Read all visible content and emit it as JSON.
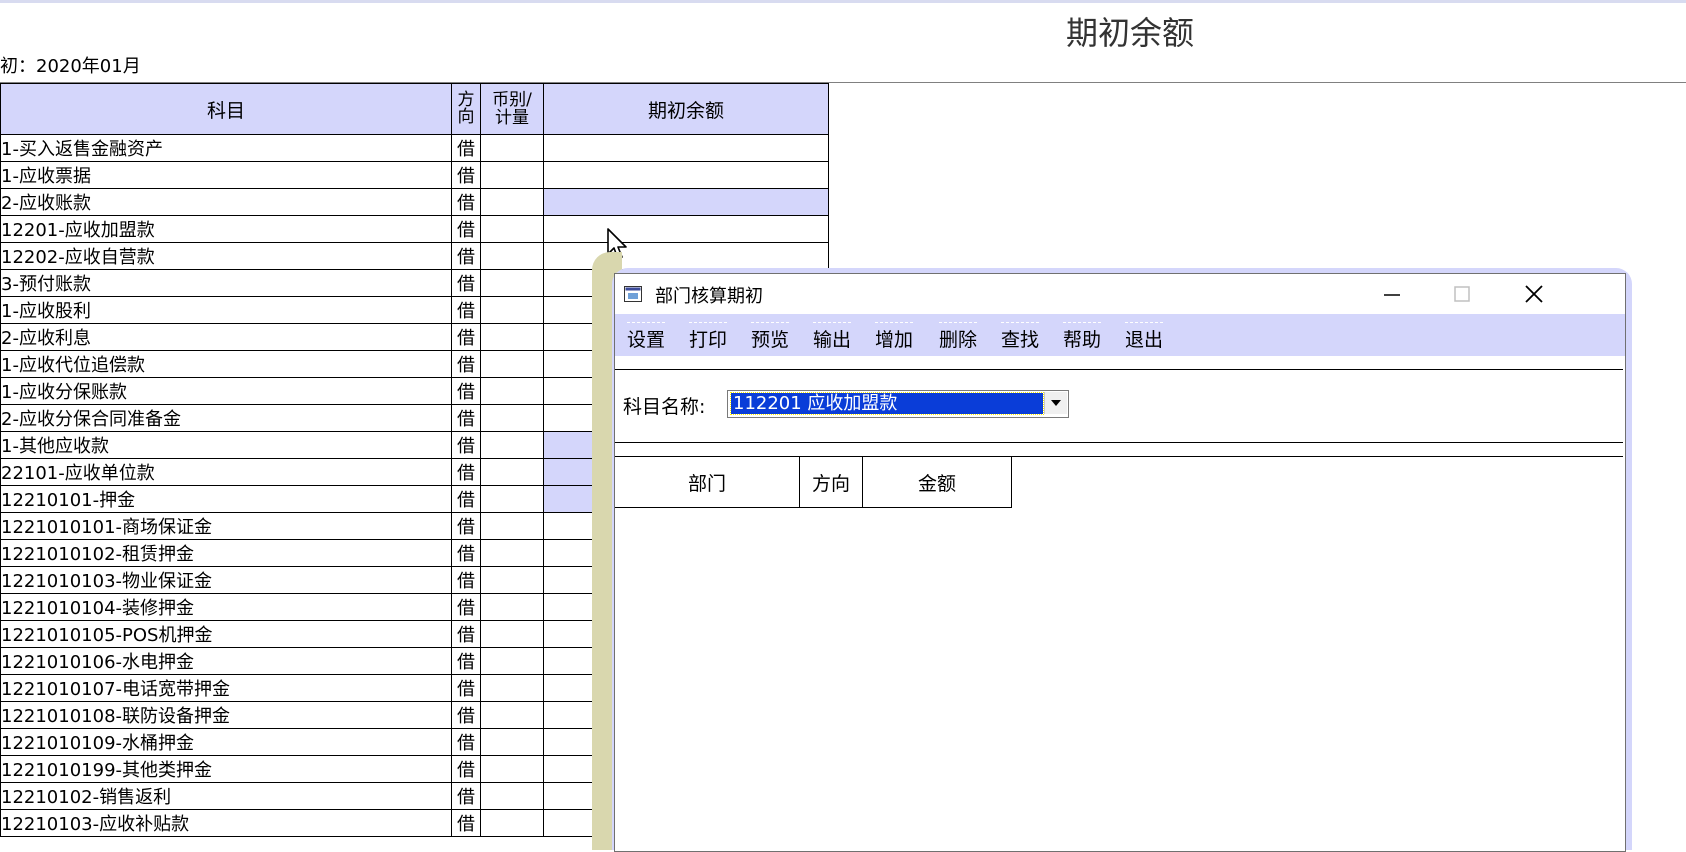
{
  "report": {
    "title": "期初余额",
    "period": "初：2020年01月"
  },
  "grid": {
    "headers": {
      "subject": "科目",
      "direction_l1": "方",
      "direction_l2": "向",
      "currency_l1": "币别/",
      "currency_l2": "计量",
      "amount": "期初余额"
    },
    "rows": [
      {
        "subject": "1-买入返售金融资产",
        "dir": "借",
        "level": 1,
        "hl": false
      },
      {
        "subject": "1-应收票据",
        "dir": "借",
        "level": 1,
        "hl": false
      },
      {
        "subject": "2-应收账款",
        "dir": "借",
        "level": 1,
        "hl": true
      },
      {
        "subject": "12201-应收加盟款",
        "dir": "借",
        "level": 1,
        "hl": false
      },
      {
        "subject": "12202-应收自营款",
        "dir": "借",
        "level": 1,
        "hl": false
      },
      {
        "subject": "3-预付账款",
        "dir": "借",
        "level": 1,
        "hl": false
      },
      {
        "subject": "1-应收股利",
        "dir": "借",
        "level": 1,
        "hl": false
      },
      {
        "subject": "2-应收利息",
        "dir": "借",
        "level": 1,
        "hl": false
      },
      {
        "subject": "1-应收代位追偿款",
        "dir": "借",
        "level": 1,
        "hl": false
      },
      {
        "subject": "1-应收分保账款",
        "dir": "借",
        "level": 1,
        "hl": false
      },
      {
        "subject": "2-应收分保合同准备金",
        "dir": "借",
        "level": 1,
        "hl": false
      },
      {
        "subject": "1-其他应收款",
        "dir": "借",
        "level": 1,
        "hl": true
      },
      {
        "subject": "22101-应收单位款",
        "dir": "借",
        "level": 1,
        "hl": true
      },
      {
        "subject": "12210101-押金",
        "dir": "借",
        "level": 2,
        "hl": true
      },
      {
        "subject": "1221010101-商场保证金",
        "dir": "借",
        "level": 3,
        "hl": false
      },
      {
        "subject": "1221010102-租赁押金",
        "dir": "借",
        "level": 3,
        "hl": false
      },
      {
        "subject": "1221010103-物业保证金",
        "dir": "借",
        "level": 3,
        "hl": false
      },
      {
        "subject": "1221010104-装修押金",
        "dir": "借",
        "level": 3,
        "hl": false
      },
      {
        "subject": "1221010105-POS机押金",
        "dir": "借",
        "level": 3,
        "hl": false
      },
      {
        "subject": "1221010106-水电押金",
        "dir": "借",
        "level": 3,
        "hl": false
      },
      {
        "subject": "1221010107-电话宽带押金",
        "dir": "借",
        "level": 3,
        "hl": false
      },
      {
        "subject": "1221010108-联防设备押金",
        "dir": "借",
        "level": 3,
        "hl": false
      },
      {
        "subject": "1221010109-水桶押金",
        "dir": "借",
        "level": 3,
        "hl": false
      },
      {
        "subject": "1221010199-其他类押金",
        "dir": "借",
        "level": 3,
        "hl": false
      },
      {
        "subject": "12210102-销售返利",
        "dir": "借",
        "level": 2,
        "hl": false
      },
      {
        "subject": "12210103-应收补贴款",
        "dir": "借",
        "level": 2,
        "hl": false
      }
    ]
  },
  "dialog": {
    "title": "部门核算期初",
    "icon": "app-window-icon",
    "menu": [
      "设置",
      "打印",
      "预览",
      "输出",
      "增加",
      "删除",
      "查找",
      "帮助",
      "退出"
    ],
    "filter_label": "科目名称:",
    "subject_value": "112201 应收加盟款",
    "columns": [
      "部门",
      "方向",
      "金额"
    ]
  },
  "colors": {
    "header_bg": "#d4d6fb",
    "selection": "#0a3dd8",
    "shadow": "#d9d7ae"
  }
}
